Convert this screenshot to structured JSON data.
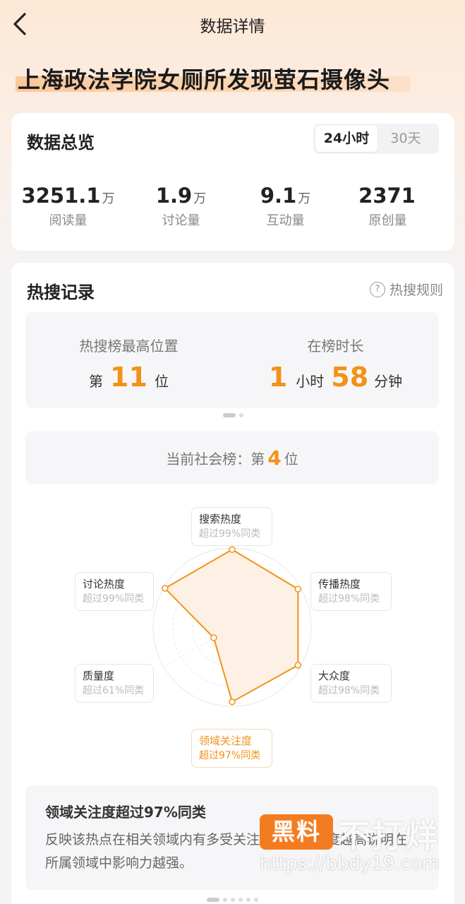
{
  "header": {
    "title": "数据详情",
    "back_icon": "chevron-left-icon"
  },
  "topic": {
    "title": "上海政法学院女厕所发现萤石摄像头"
  },
  "overview": {
    "title": "数据总览",
    "tabs": [
      {
        "label": "24小时",
        "active": true
      },
      {
        "label": "30天",
        "active": false
      }
    ],
    "stats": [
      {
        "value": "3251.1",
        "unit": "万",
        "label": "阅读量"
      },
      {
        "value": "1.9",
        "unit": "万",
        "label": "讨论量"
      },
      {
        "value": "9.1",
        "unit": "万",
        "label": "互动量"
      },
      {
        "value": "2371",
        "unit": "",
        "label": "原创量"
      }
    ]
  },
  "hot": {
    "title": "热搜记录",
    "rules_label": "热搜规则",
    "rules_icon": "question-circle-icon",
    "highest": {
      "label": "热搜榜最高位置",
      "prefix": "第",
      "value": "11",
      "suffix": "位"
    },
    "duration": {
      "label": "在榜时长",
      "hours": "1",
      "hours_unit": "小时",
      "minutes": "58",
      "minutes_unit": "分钟"
    },
    "rank": {
      "prefix": "当前社会榜：第",
      "value": "4",
      "suffix": "位"
    },
    "radar": {
      "dimensions": [
        {
          "name": "搜索热度",
          "sub": "超过99%同类",
          "percent": 99,
          "selected": false
        },
        {
          "name": "传播热度",
          "sub": "超过98%同类",
          "percent": 98,
          "selected": false
        },
        {
          "name": "大众度",
          "sub": "超过98%同类",
          "percent": 98,
          "selected": false
        },
        {
          "name": "领域关注度",
          "sub": "超过97%同类",
          "percent": 97,
          "selected": true
        },
        {
          "name": "质量度",
          "sub": "超过61%同类",
          "percent": 61,
          "selected": false
        },
        {
          "name": "讨论热度",
          "sub": "超过99%同类",
          "percent": 99,
          "selected": false
        }
      ],
      "line_color": "#f29218",
      "fill_color": "#fdeee2"
    },
    "description": {
      "title": "领域关注度超过97%同类",
      "text": "反映该热点在相关领域内有多受关注，领域关注度越高说明在所属领域中影响力越强。"
    }
  },
  "watermark": {
    "badge": "黑料",
    "text": "不打烊",
    "url": "https://bbdy19.com"
  },
  "colors": {
    "accent": "#f29218",
    "watermark_badge": "#f47c20"
  }
}
